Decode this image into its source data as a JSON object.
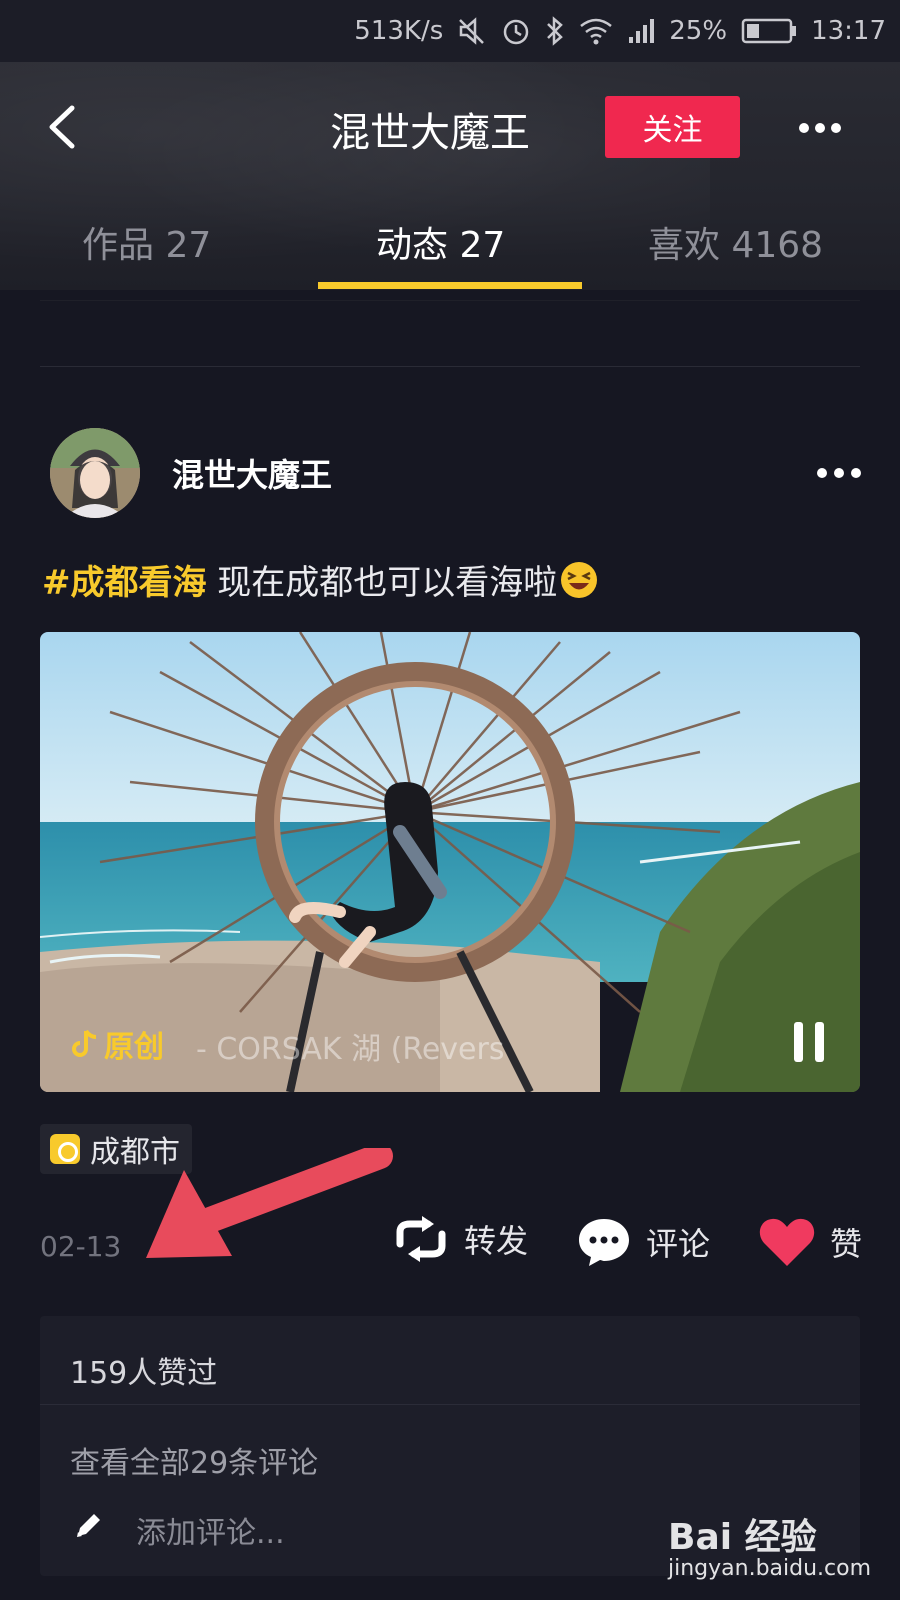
{
  "status_bar": {
    "network_speed": "513K/s",
    "battery": "25%",
    "time": "13:17"
  },
  "header": {
    "title": "混世大魔王",
    "follow_label": "关注"
  },
  "tabs": [
    {
      "label": "作品 27",
      "active": false
    },
    {
      "label": "动态 27",
      "active": true
    },
    {
      "label": "喜欢 4168",
      "active": false
    }
  ],
  "post": {
    "author": "混世大魔王",
    "hashtag": "#成都看海",
    "text": " 现在成都也可以看海啦",
    "music_label": "原创",
    "music_text": "- CORSAK    湖 (Revers",
    "location": "成都市",
    "date": "02-13",
    "actions": {
      "share": "转发",
      "comment": "评论",
      "like": "赞"
    },
    "likes_count": "159人赞过",
    "view_comments": "查看全部29条评论",
    "add_comment_placeholder": "添加评论..."
  },
  "watermark": {
    "brand": "Bai 经验",
    "url": "jingyan.baidu.com"
  },
  "colors": {
    "accent_yellow": "#f8ca2c",
    "follow_red": "#f0284f",
    "background": "#161722",
    "like_red": "#f03a5f"
  }
}
